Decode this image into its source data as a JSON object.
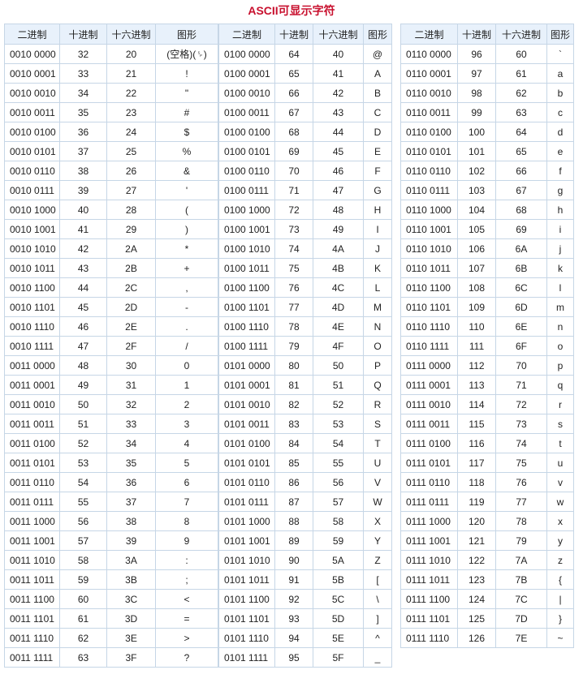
{
  "title": "ASCII可显示字符",
  "tables": [
    {
      "headers": [
        "二进制",
        "十进制",
        "十六进制",
        "图形"
      ],
      "rows": [
        [
          "0010 0000",
          "32",
          "20",
          "(空格)(␠)"
        ],
        [
          "0010 0001",
          "33",
          "21",
          "!"
        ],
        [
          "0010 0010",
          "34",
          "22",
          "\""
        ],
        [
          "0010 0011",
          "35",
          "23",
          "#"
        ],
        [
          "0010 0100",
          "36",
          "24",
          "$"
        ],
        [
          "0010 0101",
          "37",
          "25",
          "%"
        ],
        [
          "0010 0110",
          "38",
          "26",
          "&"
        ],
        [
          "0010 0111",
          "39",
          "27",
          "'"
        ],
        [
          "0010 1000",
          "40",
          "28",
          "("
        ],
        [
          "0010 1001",
          "41",
          "29",
          ")"
        ],
        [
          "0010 1010",
          "42",
          "2A",
          "*"
        ],
        [
          "0010 1011",
          "43",
          "2B",
          "+"
        ],
        [
          "0010 1100",
          "44",
          "2C",
          ","
        ],
        [
          "0010 1101",
          "45",
          "2D",
          "-"
        ],
        [
          "0010 1110",
          "46",
          "2E",
          "."
        ],
        [
          "0010 1111",
          "47",
          "2F",
          "/"
        ],
        [
          "0011 0000",
          "48",
          "30",
          "0"
        ],
        [
          "0011 0001",
          "49",
          "31",
          "1"
        ],
        [
          "0011 0010",
          "50",
          "32",
          "2"
        ],
        [
          "0011 0011",
          "51",
          "33",
          "3"
        ],
        [
          "0011 0100",
          "52",
          "34",
          "4"
        ],
        [
          "0011 0101",
          "53",
          "35",
          "5"
        ],
        [
          "0011 0110",
          "54",
          "36",
          "6"
        ],
        [
          "0011 0111",
          "55",
          "37",
          "7"
        ],
        [
          "0011 1000",
          "56",
          "38",
          "8"
        ],
        [
          "0011 1001",
          "57",
          "39",
          "9"
        ],
        [
          "0011 1010",
          "58",
          "3A",
          ":"
        ],
        [
          "0011 1011",
          "59",
          "3B",
          ";"
        ],
        [
          "0011 1100",
          "60",
          "3C",
          "<"
        ],
        [
          "0011 1101",
          "61",
          "3D",
          "="
        ],
        [
          "0011 1110",
          "62",
          "3E",
          ">"
        ],
        [
          "0011 1111",
          "63",
          "3F",
          "?"
        ]
      ]
    },
    {
      "headers": [
        "二进制",
        "十进制",
        "十六进制",
        "图形"
      ],
      "rows": [
        [
          "0100 0000",
          "64",
          "40",
          "@"
        ],
        [
          "0100 0001",
          "65",
          "41",
          "A"
        ],
        [
          "0100 0010",
          "66",
          "42",
          "B"
        ],
        [
          "0100 0011",
          "67",
          "43",
          "C"
        ],
        [
          "0100 0100",
          "68",
          "44",
          "D"
        ],
        [
          "0100 0101",
          "69",
          "45",
          "E"
        ],
        [
          "0100 0110",
          "70",
          "46",
          "F"
        ],
        [
          "0100 0111",
          "71",
          "47",
          "G"
        ],
        [
          "0100 1000",
          "72",
          "48",
          "H"
        ],
        [
          "0100 1001",
          "73",
          "49",
          "I"
        ],
        [
          "0100 1010",
          "74",
          "4A",
          "J"
        ],
        [
          "0100 1011",
          "75",
          "4B",
          "K"
        ],
        [
          "0100 1100",
          "76",
          "4C",
          "L"
        ],
        [
          "0100 1101",
          "77",
          "4D",
          "M"
        ],
        [
          "0100 1110",
          "78",
          "4E",
          "N"
        ],
        [
          "0100 1111",
          "79",
          "4F",
          "O"
        ],
        [
          "0101 0000",
          "80",
          "50",
          "P"
        ],
        [
          "0101 0001",
          "81",
          "51",
          "Q"
        ],
        [
          "0101 0010",
          "82",
          "52",
          "R"
        ],
        [
          "0101 0011",
          "83",
          "53",
          "S"
        ],
        [
          "0101 0100",
          "84",
          "54",
          "T"
        ],
        [
          "0101 0101",
          "85",
          "55",
          "U"
        ],
        [
          "0101 0110",
          "86",
          "56",
          "V"
        ],
        [
          "0101 0111",
          "87",
          "57",
          "W"
        ],
        [
          "0101 1000",
          "88",
          "58",
          "X"
        ],
        [
          "0101 1001",
          "89",
          "59",
          "Y"
        ],
        [
          "0101 1010",
          "90",
          "5A",
          "Z"
        ],
        [
          "0101 1011",
          "91",
          "5B",
          "["
        ],
        [
          "0101 1100",
          "92",
          "5C",
          "\\"
        ],
        [
          "0101 1101",
          "93",
          "5D",
          "]"
        ],
        [
          "0101 1110",
          "94",
          "5E",
          "^"
        ],
        [
          "0101 1111",
          "95",
          "5F",
          "_"
        ]
      ]
    },
    {
      "headers": [
        "二进制",
        "十进制",
        "十六进制",
        "图形"
      ],
      "rows": [
        [
          "0110 0000",
          "96",
          "60",
          "`"
        ],
        [
          "0110 0001",
          "97",
          "61",
          "a"
        ],
        [
          "0110 0010",
          "98",
          "62",
          "b"
        ],
        [
          "0110 0011",
          "99",
          "63",
          "c"
        ],
        [
          "0110 0100",
          "100",
          "64",
          "d"
        ],
        [
          "0110 0101",
          "101",
          "65",
          "e"
        ],
        [
          "0110 0110",
          "102",
          "66",
          "f"
        ],
        [
          "0110 0111",
          "103",
          "67",
          "g"
        ],
        [
          "0110 1000",
          "104",
          "68",
          "h"
        ],
        [
          "0110 1001",
          "105",
          "69",
          "i"
        ],
        [
          "0110 1010",
          "106",
          "6A",
          "j"
        ],
        [
          "0110 1011",
          "107",
          "6B",
          "k"
        ],
        [
          "0110 1100",
          "108",
          "6C",
          "l"
        ],
        [
          "0110 1101",
          "109",
          "6D",
          "m"
        ],
        [
          "0110 1110",
          "110",
          "6E",
          "n"
        ],
        [
          "0110 1111",
          "111",
          "6F",
          "o"
        ],
        [
          "0111 0000",
          "112",
          "70",
          "p"
        ],
        [
          "0111 0001",
          "113",
          "71",
          "q"
        ],
        [
          "0111 0010",
          "114",
          "72",
          "r"
        ],
        [
          "0111 0011",
          "115",
          "73",
          "s"
        ],
        [
          "0111 0100",
          "116",
          "74",
          "t"
        ],
        [
          "0111 0101",
          "117",
          "75",
          "u"
        ],
        [
          "0111 0110",
          "118",
          "76",
          "v"
        ],
        [
          "0111 0111",
          "119",
          "77",
          "w"
        ],
        [
          "0111 1000",
          "120",
          "78",
          "x"
        ],
        [
          "0111 1001",
          "121",
          "79",
          "y"
        ],
        [
          "0111 1010",
          "122",
          "7A",
          "z"
        ],
        [
          "0111 1011",
          "123",
          "7B",
          "{"
        ],
        [
          "0111 1100",
          "124",
          "7C",
          "|"
        ],
        [
          "0111 1101",
          "125",
          "7D",
          "}"
        ],
        [
          "0111 1110",
          "126",
          "7E",
          "~"
        ]
      ]
    }
  ]
}
